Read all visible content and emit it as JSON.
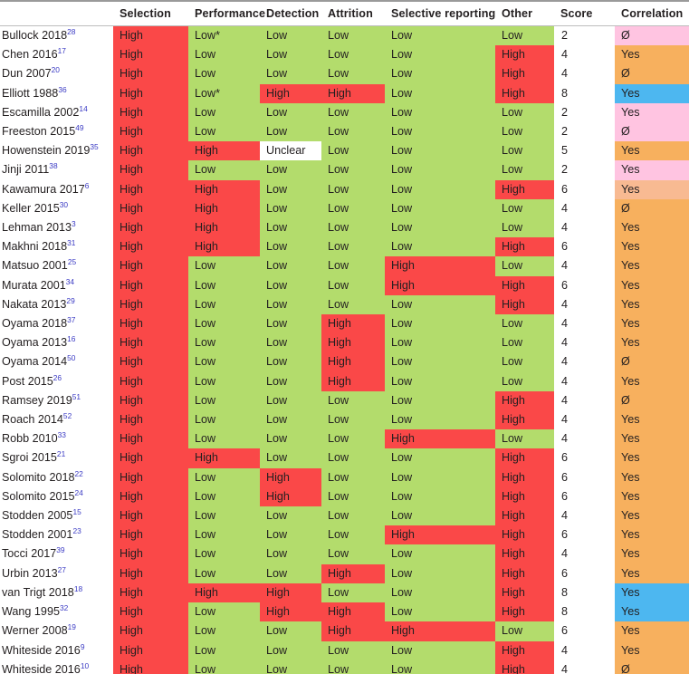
{
  "table": {
    "columns": [
      {
        "key": "study",
        "label": ""
      },
      {
        "key": "sel",
        "label": "Selection"
      },
      {
        "key": "perf",
        "label": "Performance"
      },
      {
        "key": "det",
        "label": "Detection"
      },
      {
        "key": "attr",
        "label": "Attrition"
      },
      {
        "key": "rep",
        "label": "Selective reporting"
      },
      {
        "key": "other",
        "label": "Other"
      },
      {
        "key": "score",
        "label": "Score"
      },
      {
        "key": "corr",
        "label": "Correlation"
      }
    ],
    "colors": {
      "high": "#fa4848",
      "low": "#b3dc6c",
      "unclear": "#ffffff",
      "corr_pink": "#ffc4e1",
      "corr_orange": "#f7b05e",
      "corr_blue": "#4db7f0",
      "corr_salmon": "#f8ba92",
      "superscript": "#3b3bc4",
      "text": "#231f20",
      "rule": "#9a9a9a"
    },
    "rows": [
      {
        "study": "Bullock 2018",
        "ref": "28",
        "sel": "High",
        "perf": "Low*",
        "det": "Low",
        "attr": "Low",
        "rep": "Low",
        "other": "Low",
        "score": "2",
        "corr": "Ø",
        "corr_color": "pink"
      },
      {
        "study": "Chen 2016",
        "ref": "17",
        "sel": "High",
        "perf": "Low",
        "det": "Low",
        "attr": "Low",
        "rep": "Low",
        "other": "High",
        "score": "4",
        "corr": "Yes",
        "corr_color": "orange"
      },
      {
        "study": "Dun 2007",
        "ref": "20",
        "sel": "High",
        "perf": "Low",
        "det": "Low",
        "attr": "Low",
        "rep": "Low",
        "other": "High",
        "score": "4",
        "corr": "Ø",
        "corr_color": "orange"
      },
      {
        "study": "Elliott 1988",
        "ref": "36",
        "sel": "High",
        "perf": "Low*",
        "det": "High",
        "attr": "High",
        "rep": "Low",
        "other": "High",
        "score": "8",
        "corr": "Yes",
        "corr_color": "blue"
      },
      {
        "study": "Escamilla 2002",
        "ref": "14",
        "sel": "High",
        "perf": "Low",
        "det": "Low",
        "attr": "Low",
        "rep": "Low",
        "other": "Low",
        "score": "2",
        "corr": "Yes",
        "corr_color": "pink"
      },
      {
        "study": "Freeston 2015",
        "ref": "49",
        "sel": "High",
        "perf": "Low",
        "det": "Low",
        "attr": "Low",
        "rep": "Low",
        "other": "Low",
        "score": "2",
        "corr": "Ø",
        "corr_color": "pink"
      },
      {
        "study": "Howenstein 2019",
        "ref": "35",
        "sel": "High",
        "perf": "High",
        "det": "Unclear",
        "attr": "Low",
        "rep": "Low",
        "other": "Low",
        "score": "5",
        "corr": "Yes",
        "corr_color": "orange"
      },
      {
        "study": "Jinji 2011",
        "ref": "38",
        "sel": "High",
        "perf": "Low",
        "det": "Low",
        "attr": "Low",
        "rep": "Low",
        "other": "Low",
        "score": "2",
        "corr": "Yes",
        "corr_color": "pink"
      },
      {
        "study": "Kawamura 2017",
        "ref": "6",
        "sel": "High",
        "perf": "High",
        "det": "Low",
        "attr": "Low",
        "rep": "Low",
        "other": "High",
        "score": "6",
        "corr": "Yes",
        "corr_color": "salmon"
      },
      {
        "study": "Keller 2015",
        "ref": "30",
        "sel": "High",
        "perf": "High",
        "det": "Low",
        "attr": "Low",
        "rep": "Low",
        "other": "Low",
        "score": "4",
        "corr": "Ø",
        "corr_color": "orange"
      },
      {
        "study": "Lehman 2013",
        "ref": "3",
        "sel": "High",
        "perf": "High",
        "det": "Low",
        "attr": "Low",
        "rep": "Low",
        "other": "Low",
        "score": "4",
        "corr": "Yes",
        "corr_color": "orange"
      },
      {
        "study": "Makhni 2018",
        "ref": "31",
        "sel": "High",
        "perf": "High",
        "det": "Low",
        "attr": "Low",
        "rep": "Low",
        "other": "High",
        "score": "6",
        "corr": "Yes",
        "corr_color": "orange"
      },
      {
        "study": "Matsuo 2001",
        "ref": "25",
        "sel": "High",
        "perf": "Low",
        "det": "Low",
        "attr": "Low",
        "rep": "High",
        "other": "Low",
        "score": "4",
        "corr": "Yes",
        "corr_color": "orange"
      },
      {
        "study": "Murata 2001",
        "ref": "34",
        "sel": "High",
        "perf": "Low",
        "det": "Low",
        "attr": "Low",
        "rep": "High",
        "other": "High",
        "score": "6",
        "corr": "Yes",
        "corr_color": "orange"
      },
      {
        "study": "Nakata 2013",
        "ref": "29",
        "sel": "High",
        "perf": "Low",
        "det": "Low",
        "attr": "Low",
        "rep": "Low",
        "other": "High",
        "score": "4",
        "corr": "Yes",
        "corr_color": "orange"
      },
      {
        "study": "Oyama 2018",
        "ref": "37",
        "sel": "High",
        "perf": "Low",
        "det": "Low",
        "attr": "High",
        "rep": "Low",
        "other": "Low",
        "score": "4",
        "corr": "Yes",
        "corr_color": "orange"
      },
      {
        "study": "Oyama 2013",
        "ref": "16",
        "sel": "High",
        "perf": "Low",
        "det": "Low",
        "attr": "High",
        "rep": "Low",
        "other": "Low",
        "score": "4",
        "corr": "Yes",
        "corr_color": "orange"
      },
      {
        "study": "Oyama 2014",
        "ref": "50",
        "sel": "High",
        "perf": "Low",
        "det": "Low",
        "attr": "High",
        "rep": "Low",
        "other": "Low",
        "score": "4",
        "corr": "Ø",
        "corr_color": "orange"
      },
      {
        "study": "Post 2015",
        "ref": "26",
        "sel": "High",
        "perf": "Low",
        "det": "Low",
        "attr": "High",
        "rep": "Low",
        "other": "Low",
        "score": "4",
        "corr": "Yes",
        "corr_color": "orange"
      },
      {
        "study": "Ramsey 2019",
        "ref": "51",
        "sel": "High",
        "perf": "Low",
        "det": "Low",
        "attr": "Low",
        "rep": "Low",
        "other": "High",
        "score": "4",
        "corr": "Ø",
        "corr_color": "orange"
      },
      {
        "study": "Roach 2014",
        "ref": "52",
        "sel": "High",
        "perf": "Low",
        "det": "Low",
        "attr": "Low",
        "rep": "Low",
        "other": "High",
        "score": "4",
        "corr": "Yes",
        "corr_color": "orange"
      },
      {
        "study": "Robb 2010",
        "ref": "33",
        "sel": "High",
        "perf": "Low",
        "det": "Low",
        "attr": "Low",
        "rep": "High",
        "other": "Low",
        "score": "4",
        "corr": "Yes",
        "corr_color": "orange"
      },
      {
        "study": "Sgroi 2015",
        "ref": "21",
        "sel": "High",
        "perf": "High",
        "det": "Low",
        "attr": "Low",
        "rep": "Low",
        "other": "High",
        "score": "6",
        "corr": "Yes",
        "corr_color": "orange"
      },
      {
        "study": "Solomito 2018",
        "ref": "22",
        "sel": "High",
        "perf": "Low",
        "det": "High",
        "attr": "Low",
        "rep": "Low",
        "other": "High",
        "score": "6",
        "corr": "Yes",
        "corr_color": "orange"
      },
      {
        "study": "Solomito 2015",
        "ref": "24",
        "sel": "High",
        "perf": "Low",
        "det": "High",
        "attr": "Low",
        "rep": "Low",
        "other": "High",
        "score": "6",
        "corr": "Yes",
        "corr_color": "orange"
      },
      {
        "study": "Stodden 2005",
        "ref": "15",
        "sel": "High",
        "perf": "Low",
        "det": "Low",
        "attr": "Low",
        "rep": "Low",
        "other": "High",
        "score": "4",
        "corr": "Yes",
        "corr_color": "orange"
      },
      {
        "study": "Stodden 2001",
        "ref": "23",
        "sel": "High",
        "perf": "Low",
        "det": "Low",
        "attr": "Low",
        "rep": "High",
        "other": "High",
        "score": "6",
        "corr": "Yes",
        "corr_color": "orange"
      },
      {
        "study": "Tocci 2017",
        "ref": "39",
        "sel": "High",
        "perf": "Low",
        "det": "Low",
        "attr": "Low",
        "rep": "Low",
        "other": "High",
        "score": "4",
        "corr": "Yes",
        "corr_color": "orange"
      },
      {
        "study": "Urbin 2013",
        "ref": "27",
        "sel": "High",
        "perf": "Low",
        "det": "Low",
        "attr": "High",
        "rep": "Low",
        "other": "High",
        "score": "6",
        "corr": "Yes",
        "corr_color": "orange"
      },
      {
        "study": "van Trigt 2018",
        "ref": "18",
        "sel": "High",
        "perf": "High",
        "det": "High",
        "attr": "Low",
        "rep": "Low",
        "other": "High",
        "score": "8",
        "corr": "Yes",
        "corr_color": "blue"
      },
      {
        "study": "Wang 1995",
        "ref": "32",
        "sel": "High",
        "perf": "Low",
        "det": "High",
        "attr": "High",
        "rep": "Low",
        "other": "High",
        "score": "8",
        "corr": "Yes",
        "corr_color": "blue"
      },
      {
        "study": "Werner 2008",
        "ref": "19",
        "sel": "High",
        "perf": "Low",
        "det": "Low",
        "attr": "High",
        "rep": "High",
        "other": "Low",
        "score": "6",
        "corr": "Yes",
        "corr_color": "orange"
      },
      {
        "study": "Whiteside 2016",
        "ref": "9",
        "sel": "High",
        "perf": "Low",
        "det": "Low",
        "attr": "Low",
        "rep": "Low",
        "other": "High",
        "score": "4",
        "corr": "Yes",
        "corr_color": "orange"
      },
      {
        "study": "Whiteside 2016",
        "ref": "10",
        "sel": "High",
        "perf": "Low",
        "det": "Low",
        "attr": "Low",
        "rep": "Low",
        "other": "High",
        "score": "4",
        "corr": "Ø",
        "corr_color": "orange"
      }
    ]
  }
}
